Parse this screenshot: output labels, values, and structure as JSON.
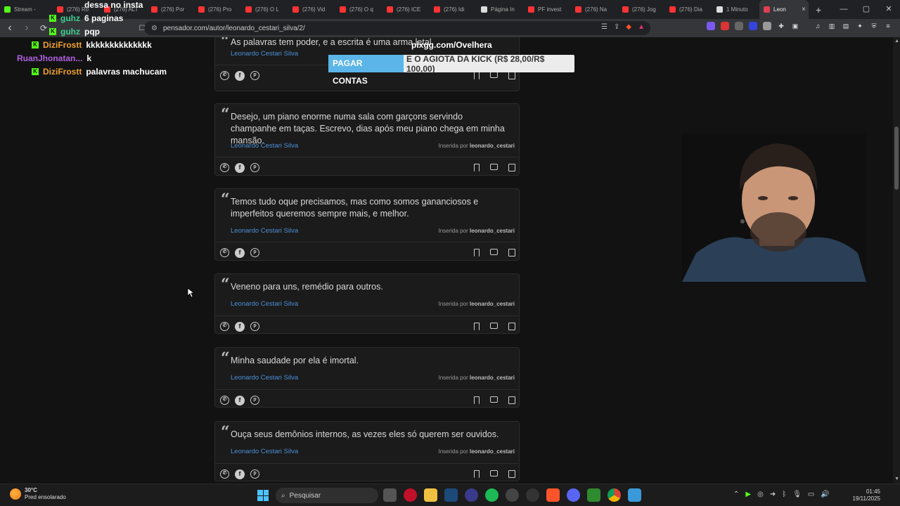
{
  "tabs": [
    {
      "label": "Stream -",
      "color": "#53fc18"
    },
    {
      "label": "(276) Ro",
      "color": "#ff3333"
    },
    {
      "label": "(276) ALT",
      "color": "#ff3333"
    },
    {
      "label": "(276) Por",
      "color": "#ff3333"
    },
    {
      "label": "(276) Pro",
      "color": "#ff3333"
    },
    {
      "label": "(276) O L",
      "color": "#ff3333"
    },
    {
      "label": "(276) Vid",
      "color": "#ff3333"
    },
    {
      "label": "(276) O q",
      "color": "#ff3333"
    },
    {
      "label": "(276) ICE",
      "color": "#ff3333"
    },
    {
      "label": "(276) Idi",
      "color": "#ff3333"
    },
    {
      "label": "Página In",
      "color": "#dddddd"
    },
    {
      "label": "PF invest",
      "color": "#ff3333"
    },
    {
      "label": "(276) Na",
      "color": "#ff3333"
    },
    {
      "label": "(276) Jog",
      "color": "#ff3333"
    },
    {
      "label": "(276) Dia",
      "color": "#ff3333"
    },
    {
      "label": "1 Minuto",
      "color": "#dddddd"
    }
  ],
  "active_tab": {
    "label": "Leon",
    "close": "×"
  },
  "new_tab": "+",
  "window_controls": {
    "minimize": "—",
    "maximize": "▢",
    "close": "✕"
  },
  "toolbar": {
    "back": "‹",
    "forward": "›",
    "reload": "⟳",
    "bookmark": "☐"
  },
  "url": "pensador.com/autor/leonardo_cestari_silva/2/",
  "chat": [
    {
      "user": "",
      "message": "dessa no insta",
      "color": "#ffffff",
      "badge": false
    },
    {
      "user": "guhz",
      "message": "6 paginas",
      "color": "#3ecf8e",
      "badge": true
    },
    {
      "user": "guhz",
      "message": "pqp",
      "color": "#3ecf8e",
      "badge": true
    },
    {
      "user": "DiziFrostt",
      "message": "kkkkkkkkkkkkkk",
      "color": "#f0a030",
      "badge": true
    },
    {
      "user": "RuanJhonatan...",
      "message": "k",
      "color": "#b060e0",
      "badge": false
    },
    {
      "user": "DiziFrostt",
      "message": "palavras machucam",
      "color": "#f0a030",
      "badge": true
    }
  ],
  "banner": {
    "title": "pixgg.com/Ovelhera",
    "highlight": "PAGAR CONTAS",
    "rest": "E O AGIOTA DA KICK (R$ 28,00/R$ 100,00)"
  },
  "quotes": [
    {
      "text": "As palavras tem poder, e a escrita é uma arma letal.",
      "author": "Leonardo Cestari Silva",
      "inserted_prefix": "",
      "inserted_by": ""
    },
    {
      "text": "Desejo, um piano enorme numa sala com garçons servindo champanhe em taças. Escrevo, dias após meu piano chega em minha mansão.",
      "author": "Leonardo Cestari Silva",
      "inserted_prefix": "Inserida por",
      "inserted_by": "leonardo_cestari"
    },
    {
      "text": "Temos tudo oque precisamos, mas como somos gananciosos e imperfeitos queremos sempre mais, e melhor.",
      "author": "Leonardo Cestari Silva",
      "inserted_prefix": "Inserida por",
      "inserted_by": "leonardo_cestari"
    },
    {
      "text": "Veneno para uns, remédio para outros.",
      "author": "Leonardo Cestari Silva",
      "inserted_prefix": "Inserida por",
      "inserted_by": "leonardo_cestari"
    },
    {
      "text": "Minha saudade por ela é imortal.",
      "author": "Leonardo Cestari Silva",
      "inserted_prefix": "Inserida por",
      "inserted_by": "leonardo_cestari"
    },
    {
      "text": "Ouça seus demônios internos, as vezes eles só querem ser ouvidos.",
      "author": "Leonardo Cestari Silva",
      "inserted_prefix": "Inserida por",
      "inserted_by": "leonardo_cestari"
    }
  ],
  "taskbar": {
    "temperature": "30°C",
    "weather": "Pred ensolarado",
    "search_placeholder": "Pesquisar",
    "time": "01:45",
    "date": "19/11/2025"
  }
}
